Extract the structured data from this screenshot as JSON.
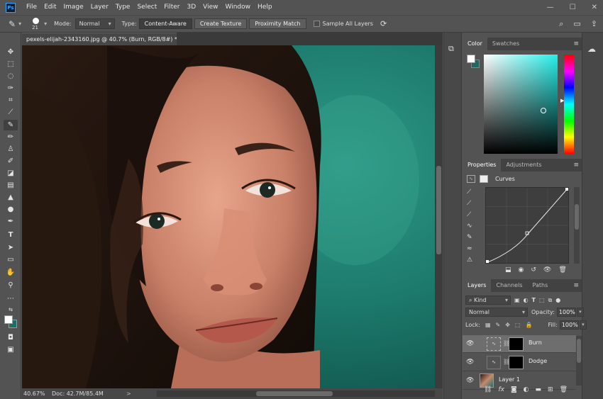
{
  "app": {
    "logo": "Ps"
  },
  "menu": [
    "File",
    "Edit",
    "Image",
    "Layer",
    "Type",
    "Select",
    "Filter",
    "3D",
    "View",
    "Window",
    "Help"
  ],
  "window_controls": {
    "minimize": "—",
    "maximize": "☐",
    "close": "✕"
  },
  "options_bar": {
    "brush_size": "21",
    "mode_label": "Mode:",
    "mode_value": "Normal",
    "type_label": "Type:",
    "type_buttons": [
      "Content-Aware",
      "Create Texture",
      "Proximity Match"
    ],
    "sample_all_layers": "Sample All Layers"
  },
  "document": {
    "tab_title": "pexels-elijah-2343160.jpg @ 40.7% (Burn, RGB/8#) *",
    "status_zoom": "40.67%",
    "status_doc": "Doc: 42.7M/85.4M",
    "status_arrow": ">"
  },
  "color_panel": {
    "tabs": [
      "Color",
      "Swatches"
    ],
    "foreground": "#ffffff",
    "background": "#1e6962"
  },
  "properties_panel": {
    "tabs": [
      "Properties",
      "Adjustments"
    ],
    "title": "Curves"
  },
  "layers_panel": {
    "tabs": [
      "Layers",
      "Channels",
      "Paths"
    ],
    "filter": "Kind",
    "blend_mode": "Normal",
    "opacity_label": "Opacity:",
    "opacity_value": "100%",
    "lock_label": "Lock:",
    "fill_label": "Fill:",
    "fill_value": "100%",
    "layers": [
      {
        "name": "Burn",
        "selected": true
      },
      {
        "name": "Dodge",
        "selected": false
      },
      {
        "name": "Layer 1",
        "selected": false
      }
    ]
  }
}
